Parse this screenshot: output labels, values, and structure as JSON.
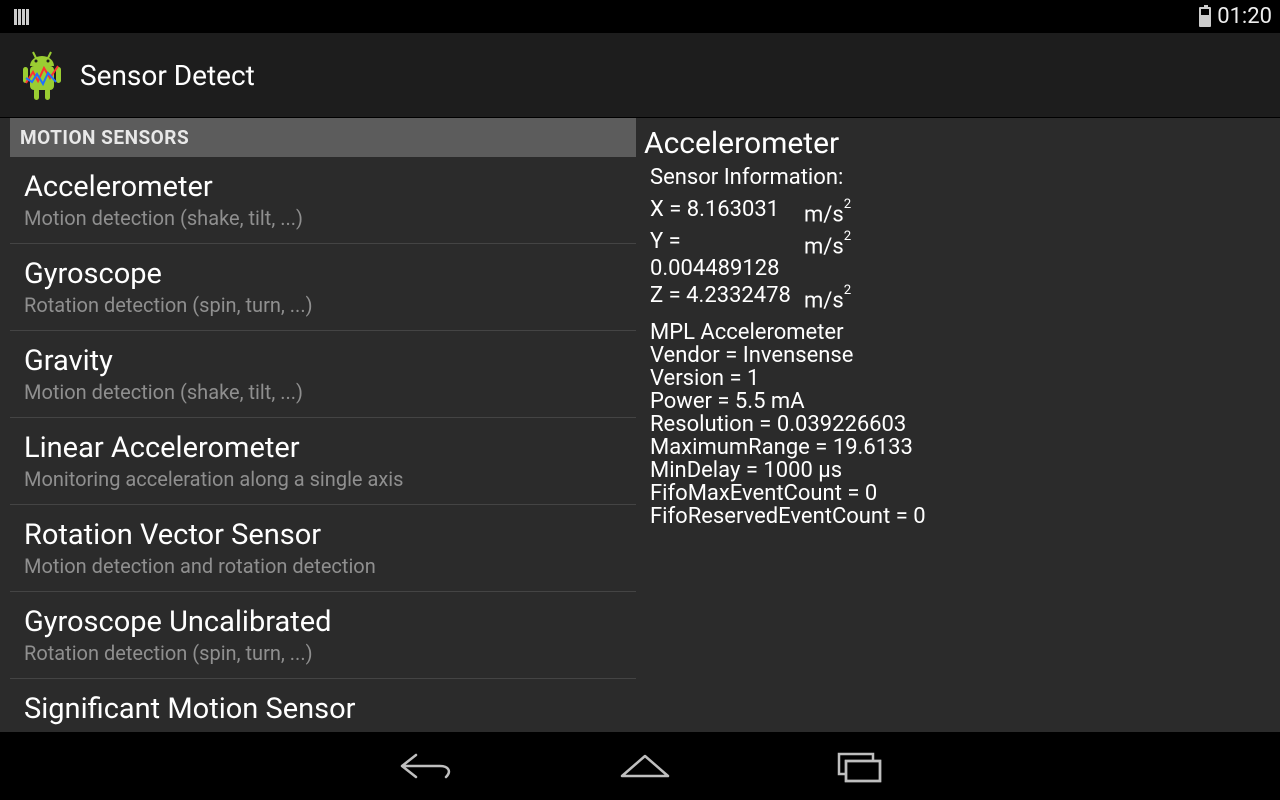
{
  "status": {
    "time": "01:20"
  },
  "header": {
    "title": "Sensor Detect"
  },
  "section_label": "MOTION SENSORS",
  "sensors": [
    {
      "title": "Accelerometer",
      "sub": "Motion detection (shake, tilt, ...)"
    },
    {
      "title": "Gyroscope",
      "sub": "Rotation detection (spin, turn, ...)"
    },
    {
      "title": "Gravity",
      "sub": "Motion detection (shake, tilt, ...)"
    },
    {
      "title": "Linear Accelerometer",
      "sub": "Monitoring acceleration along a single axis"
    },
    {
      "title": "Rotation Vector Sensor",
      "sub": "Motion detection and rotation detection"
    },
    {
      "title": "Gyroscope Uncalibrated",
      "sub": "Rotation detection (spin, turn, ...)"
    },
    {
      "title": "Significant Motion Sensor",
      "sub": ""
    }
  ],
  "detail": {
    "title": "Accelerometer",
    "subtitle": "Sensor Information:",
    "readings": {
      "x": {
        "label": "X = 8.163031",
        "unit_html": "m/s²"
      },
      "y": {
        "label": "Y = 0.004489128",
        "unit_html": "m/s²"
      },
      "z": {
        "label": "Z = 4.2332478",
        "unit_html": "m/s²"
      }
    },
    "info": [
      "MPL Accelerometer",
      "Vendor = Invensense",
      "Version = 1",
      "Power = 5.5 mA",
      "Resolution = 0.039226603",
      "MaximumRange = 19.6133",
      "MinDelay = 1000 μs",
      "FifoMaxEventCount = 0",
      "FifoReservedEventCount = 0"
    ]
  }
}
